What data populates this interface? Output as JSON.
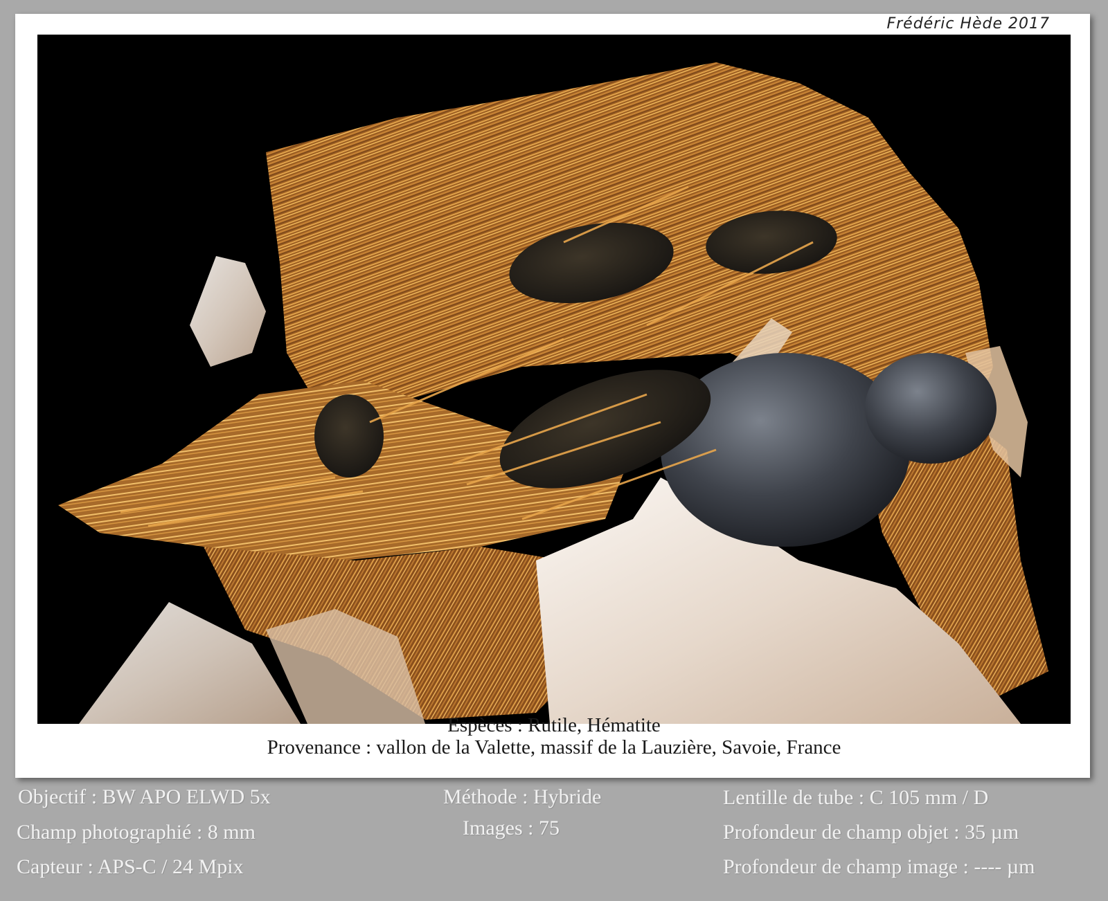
{
  "signature": "Frédéric Hède 2017",
  "caption": {
    "species": "Espèces : Rutile, Hématite",
    "origin": "Provenance : vallon de la Valette, massif de la Lauzière, Savoie, France"
  },
  "specs": {
    "col1": [
      "Objectif : BW APO ELWD 5x",
      "Champ photographié : 8 mm",
      "Capteur : APS-C / 24 Mpix"
    ],
    "col2": [
      "Méthode : Hybride",
      "Images : 75"
    ],
    "col3": [
      "Lentille de tube : C 105 mm / D",
      "Profondeur de champ objet : 35 µm",
      "Profondeur de champ image : ---- µm"
    ]
  },
  "colors": {
    "background": "#a9a9a9",
    "photo_background": "#000000",
    "rutile": "#c8842f",
    "hematite": "#3a3d44",
    "quartz": "#efe7e0"
  }
}
